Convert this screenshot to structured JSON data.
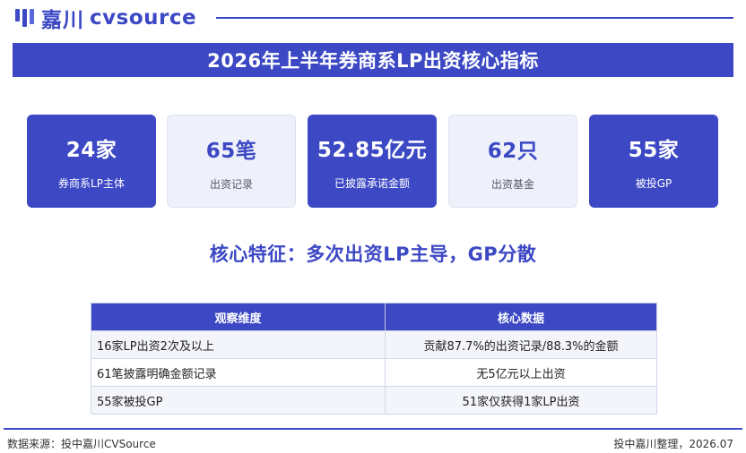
{
  "header": {
    "logo_cn": "嘉川",
    "logo_en": "cvsource",
    "brand_color": "#3c48c4"
  },
  "title": "2026年上半年券商系LP出资核心指标",
  "kpis": [
    {
      "value": "24家",
      "label": "券商系LP主体",
      "style": "dark"
    },
    {
      "value": "65笔",
      "label": "出资记录",
      "style": "light"
    },
    {
      "value": "52.85亿元",
      "label": "已披露承诺金额",
      "style": "dark"
    },
    {
      "value": "62只",
      "label": "出资基金",
      "style": "light"
    },
    {
      "value": "55家",
      "label": "被投GP",
      "style": "dark"
    }
  ],
  "subtitle": "核心特征：多次出资LP主导，GP分散",
  "table": {
    "headers": [
      "观察维度",
      "核心数据"
    ],
    "rows": [
      [
        "16家LP出资2次及以上",
        "贡献87.7%的出资记录/88.3%的金额"
      ],
      [
        "61笔披露明确金额记录",
        "无5亿元以上出资"
      ],
      [
        "55家被投GP",
        "51家仅获得1家LP出资"
      ]
    ]
  },
  "footer": {
    "source": "数据来源：投中嘉川CVSource",
    "credit": "投中嘉川整理，2026.07"
  }
}
